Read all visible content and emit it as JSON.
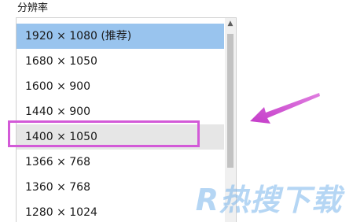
{
  "resolution": {
    "label": "分辨率",
    "options": [
      "1920 × 1080 (推荐)",
      "1680 × 1050",
      "1600 × 900",
      "1440 × 900",
      "1400 × 1050",
      "1366 × 768",
      "1360 × 768",
      "1280 × 1024"
    ],
    "selected_option": "1920 × 1080 (推荐)",
    "hovered_option": "1400 × 1050",
    "selected_color": "#99c4ee",
    "hover_color": "#e6e6e6"
  },
  "annotation": {
    "highlight_color": "#d35ad8",
    "arrow_icon": "arrow-pointing-left-down-icon"
  },
  "watermark": {
    "text": "R热搜下载"
  }
}
